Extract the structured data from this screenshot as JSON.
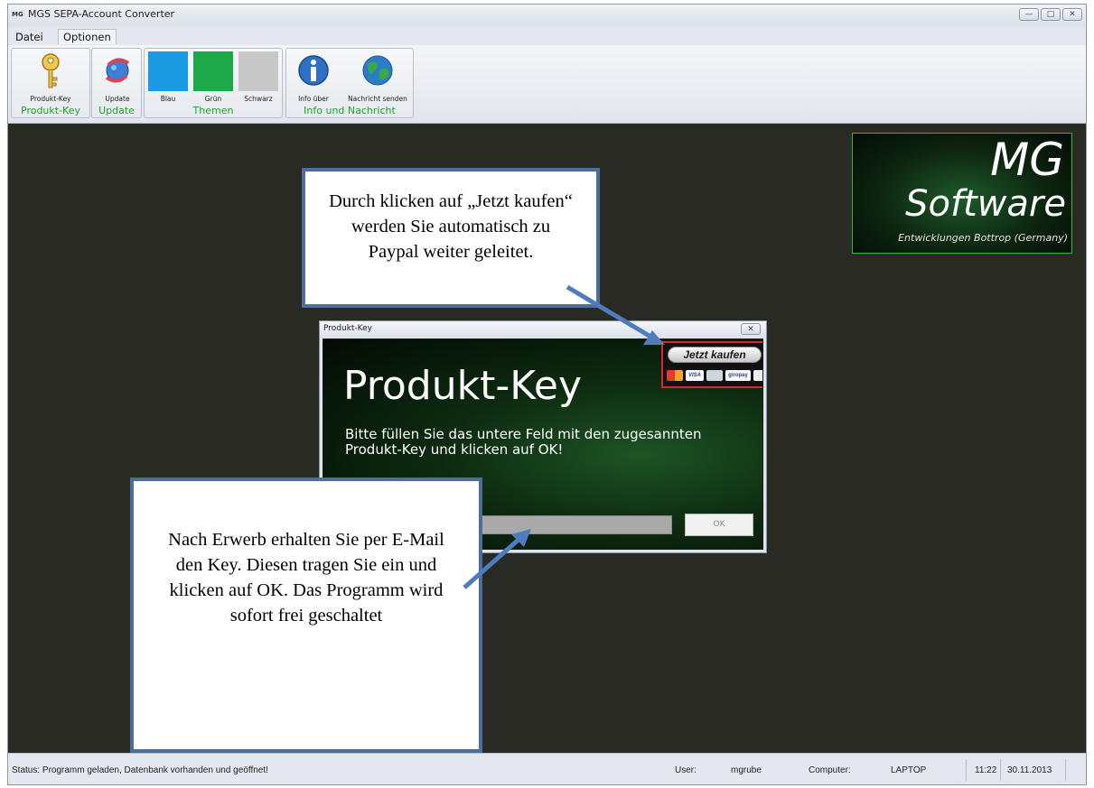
{
  "window": {
    "title": "MGS SEPA-Account Converter",
    "app_icon": "MG",
    "controls": [
      "minimize",
      "maximize",
      "close"
    ]
  },
  "menu": {
    "items": [
      {
        "label": "Datei"
      },
      {
        "label": "Optionen"
      }
    ]
  },
  "ribbon": {
    "groups": [
      {
        "title": "Produkt-Key",
        "buttons": [
          {
            "label": "Produkt-Key",
            "icon": "key-icon"
          }
        ]
      },
      {
        "title": "Update",
        "buttons": [
          {
            "label": "Update",
            "icon": "update-icon"
          }
        ]
      },
      {
        "title": "Themen",
        "buttons": [
          {
            "label": "Blau",
            "icon": "blue-swatch-icon",
            "color": "#1a9ae0"
          },
          {
            "label": "Grün",
            "icon": "green-swatch-icon",
            "color": "#1da84a"
          },
          {
            "label": "Schwarz",
            "icon": "gray-swatch-icon",
            "color": "#c8c8c8"
          }
        ]
      },
      {
        "title": "Info und Nachricht",
        "buttons": [
          {
            "label": "Info über",
            "icon": "info-icon"
          },
          {
            "label": "Nachricht senden",
            "icon": "globe-icon"
          }
        ]
      }
    ]
  },
  "logo": {
    "line1": "MG",
    "line2": "Software",
    "line3": "Entwicklungen Bottrop (Germany)"
  },
  "dialog": {
    "title": "Produkt-Key",
    "heading": "Produkt-Key",
    "text": "Bitte füllen Sie das untere Feld mit den zugesannten Produkt-Key und klicken auf OK!",
    "input_value": "",
    "ok_label": "OK",
    "buy_label": "Jetzt kaufen",
    "payment_logos": [
      "mastercard-icon",
      "visa-icon",
      "amex-icon",
      "giropay-icon",
      "lastschrift-icon"
    ],
    "payment_labels": {
      "visa": "VISA",
      "giropay": "giropay"
    }
  },
  "callouts": {
    "top": "Durch klicken auf „Jetzt kaufen“ werden Sie automatisch zu Paypal weiter geleitet.",
    "bottom": "Nach Erwerb erhalten Sie per E-Mail den Key. Diesen tragen Sie ein und klicken auf OK. Das Programm wird sofort frei geschaltet"
  },
  "status": {
    "message": "Status: Programm geladen, Datenbank vorhanden und geöffnet!",
    "user_label": "User:",
    "user": "mgrube",
    "computer_label": "Computer:",
    "computer": "LAPTOP",
    "time": "11:22",
    "date": "30.11.2013"
  },
  "colors": {
    "accent_green": "#23a22b",
    "callout_border": "#4d6d9d",
    "buy_highlight": "#d8282f"
  }
}
